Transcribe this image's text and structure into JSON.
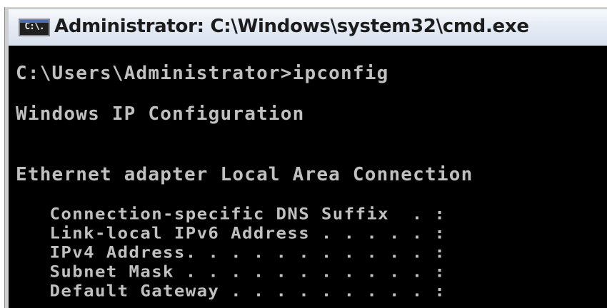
{
  "window": {
    "title": "Administrator: C:\\Windows\\system32\\cmd.exe",
    "icon_name": "cmd-icon",
    "icon_text": "C:\\."
  },
  "console": {
    "command_line": "C:\\Users\\Administrator>ipconfig",
    "heading": "Windows IP Configuration",
    "adapter": "Ethernet adapter Local Area Connection",
    "details": [
      "   Connection-specific DNS Suffix  . :",
      "   Link-local IPv6 Address . . . . . :",
      "   IPv4 Address. . . . . . . . . . . :",
      "   Subnet Mask . . . . . . . . . . . :",
      "   Default Gateway . . . . . . . . . :"
    ]
  },
  "colors": {
    "console_background": "#000000",
    "console_text": "#c0c0c0"
  }
}
